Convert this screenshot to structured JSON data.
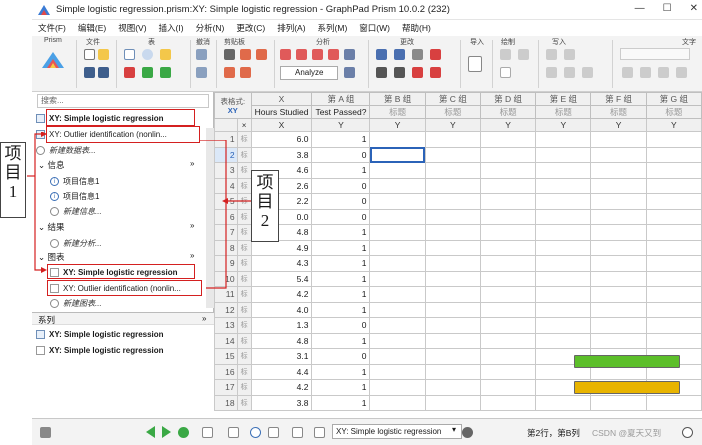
{
  "window": {
    "title": "Simple logistic regression.prism:XY: Simple logistic regression - GraphPad Prism 10.0.2 (232)",
    "controls": [
      "—",
      "☐",
      "✕"
    ]
  },
  "menu": [
    "文件(F)",
    "编辑(E)",
    "视图(V)",
    "插入(I)",
    "分析(N)",
    "更改(C)",
    "排列(A)",
    "系列(M)",
    "窗口(W)",
    "帮助(H)"
  ],
  "ribbon": {
    "groups": [
      "Prism",
      "文件",
      "表",
      "撤消",
      "剪贴板",
      "分析",
      "更改",
      "导入",
      "绘制",
      "写入",
      "文字"
    ],
    "analyze_label": "Analyze"
  },
  "navigator": {
    "search_placeholder": "搜索...",
    "sections": {
      "data_items": [
        "XY: Simple logistic regression",
        "XY: Outlier identification (nonlin..."
      ],
      "new_data": "新建数据表...",
      "info_title": "信息",
      "info_items": [
        "项目信息1",
        "项目信息1"
      ],
      "new_info": "新建信息...",
      "results_title": "结果",
      "new_analysis": "新建分析...",
      "graphs_title": "图表",
      "graph_items": [
        "XY: Simple logistic regression",
        "XY: Outlier identification (nonlin..."
      ],
      "new_graph": "新建图表..."
    },
    "series_title": "系列",
    "series_items": [
      "XY: Simple logistic regression",
      "XY: Simple logistic regression"
    ]
  },
  "table": {
    "corner_label": "表格式:",
    "corner_sub": "XY",
    "row_marker": "×",
    "columns": [
      {
        "header": "X",
        "title": "Hours Studied",
        "sub": "X"
      },
      {
        "header": "第 A 组",
        "title": "Test Passed?",
        "sub": "Y"
      },
      {
        "header": "第 B 组",
        "title": "标题",
        "sub": "Y"
      },
      {
        "header": "第 C 组",
        "title": "标题",
        "sub": "Y"
      },
      {
        "header": "第 D 组",
        "title": "标题",
        "sub": "Y"
      },
      {
        "header": "第 E 组",
        "title": "标题",
        "sub": "Y"
      },
      {
        "header": "第 F 组",
        "title": "标题",
        "sub": "Y"
      },
      {
        "header": "第 G 组",
        "title": "标题",
        "sub": "Y"
      }
    ],
    "row_label": "标",
    "rows": [
      {
        "n": "1",
        "x": "6.0",
        "y": "1"
      },
      {
        "n": "2",
        "x": "3.8",
        "y": "0"
      },
      {
        "n": "3",
        "x": "4.6",
        "y": "1"
      },
      {
        "n": "4",
        "x": "2.6",
        "y": "0"
      },
      {
        "n": "5",
        "x": "2.2",
        "y": "0"
      },
      {
        "n": "6",
        "x": "0.0",
        "y": "0"
      },
      {
        "n": "7",
        "x": "4.8",
        "y": "1"
      },
      {
        "n": "8",
        "x": "4.9",
        "y": "1"
      },
      {
        "n": "9",
        "x": "4.3",
        "y": "1"
      },
      {
        "n": "10",
        "x": "5.4",
        "y": "1"
      },
      {
        "n": "11",
        "x": "4.2",
        "y": "1"
      },
      {
        "n": "12",
        "x": "4.0",
        "y": "1"
      },
      {
        "n": "13",
        "x": "1.3",
        "y": "0"
      },
      {
        "n": "14",
        "x": "4.8",
        "y": "1"
      },
      {
        "n": "15",
        "x": "3.1",
        "y": "0"
      },
      {
        "n": "16",
        "x": "4.4",
        "y": "1"
      },
      {
        "n": "17",
        "x": "4.2",
        "y": "1"
      },
      {
        "n": "18",
        "x": "3.8",
        "y": "1"
      }
    ]
  },
  "statusbar": {
    "sheet_selector": "XY: Simple logistic regression",
    "position": "第2行，第B列",
    "watermark": "CSDN @夏天又到"
  },
  "annotations": {
    "item1": "项目1",
    "item2": "项目2"
  },
  "colors": {
    "highlight_red": "#d42020",
    "accent_blue": "#2b63b8",
    "green_bar": "#5cbf2a",
    "yellow_bar": "#e8b400"
  }
}
